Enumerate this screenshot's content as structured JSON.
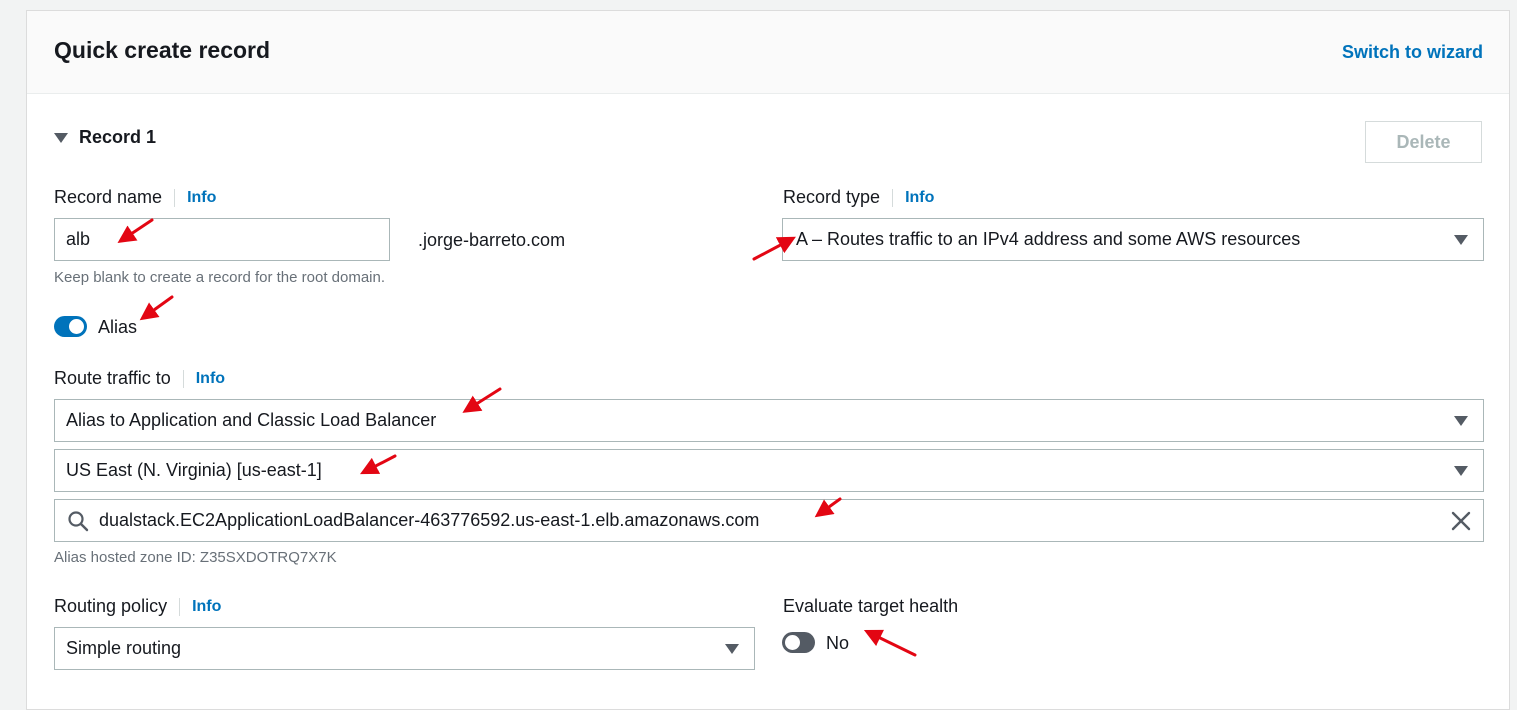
{
  "header": {
    "title": "Quick create record",
    "switch_link": "Switch to wizard"
  },
  "record": {
    "heading": "Record 1",
    "delete_label": "Delete",
    "record_name": {
      "label": "Record name",
      "info": "Info",
      "value": "alb",
      "domain_suffix": ".jorge-barreto.com",
      "hint": "Keep blank to create a record for the root domain."
    },
    "record_type": {
      "label": "Record type",
      "info": "Info",
      "value": "A – Routes traffic to an IPv4 address and some AWS resources"
    },
    "alias": {
      "label": "Alias",
      "enabled": true
    },
    "route_traffic": {
      "label": "Route traffic to",
      "info": "Info",
      "endpoint": "Alias to Application and Classic Load Balancer",
      "region": "US East (N. Virginia) [us-east-1]",
      "resource": "dualstack.EC2ApplicationLoadBalancer-463776592.us-east-1.elb.amazonaws.com",
      "hosted_zone": "Alias hosted zone ID: Z35SXDOTRQ7X7K"
    },
    "routing_policy": {
      "label": "Routing policy",
      "info": "Info",
      "value": "Simple routing"
    },
    "evaluate_health": {
      "label": "Evaluate target health",
      "value": "No",
      "enabled": false
    }
  },
  "colors": {
    "accent": "#0073bb",
    "annotation": "#e30613"
  },
  "icons": {
    "collapse": "triangle-down",
    "dropdown": "triangle-down",
    "search": "search-icon",
    "clear": "close-icon"
  }
}
